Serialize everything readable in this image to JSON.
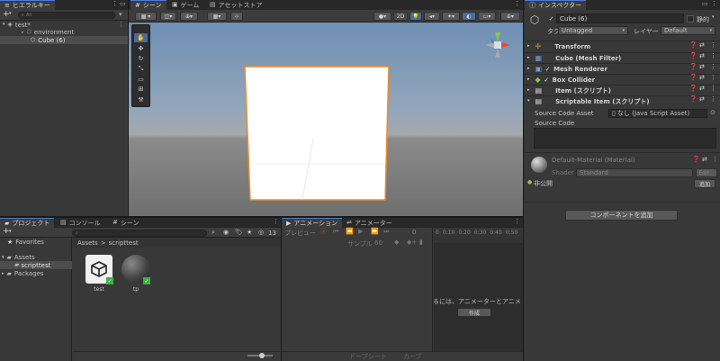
{
  "hierarchy": {
    "tab": "ヒエラルキー",
    "search_placeholder": "All",
    "scene": "test*",
    "items": [
      {
        "label": "environment"
      },
      {
        "label": "Cube (6)"
      }
    ]
  },
  "scene_view": {
    "tabs": [
      {
        "label": "シーン"
      },
      {
        "label": "ゲーム"
      },
      {
        "label": "アセットストア"
      }
    ],
    "toolbar_2d": "2D"
  },
  "inspector": {
    "tab": "インスペクター",
    "object_name": "Cube (6)",
    "static_label": "静的",
    "tag_label": "タグ",
    "tag_value": "Untagged",
    "layer_label": "レイヤー",
    "layer_value": "Default",
    "components": [
      {
        "label": "Transform",
        "icon": "transform-icon"
      },
      {
        "label": "Cube (Mesh Filter)",
        "icon": "mesh-filter-icon"
      },
      {
        "label": "Mesh Renderer",
        "icon": "mesh-renderer-icon"
      },
      {
        "label": "Box Collider",
        "icon": "box-collider-icon"
      },
      {
        "label": "Item (スクリプト)",
        "icon": "script-icon"
      },
      {
        "label": "Scriptable Item (スクリプト)",
        "icon": "script-icon"
      }
    ],
    "source_code_asset_label": "Source Code Asset",
    "source_code_asset_value": "なし (Java Script Asset)",
    "source_code_label": "Source Code",
    "material_name": "Default-Material (Material)",
    "shader_label": "Shader",
    "shader_value": "Standard",
    "edit_label": "Edit...",
    "private_label": "非公開",
    "add_label": "追加",
    "add_component_label": "コンポーネントを追加"
  },
  "project": {
    "tabs": [
      {
        "label": "プロジェクト"
      },
      {
        "label": "コンソール"
      },
      {
        "label": "シーン"
      }
    ],
    "favorites": "Favorites",
    "assets": "Assets",
    "scripttest": "scripttest",
    "packages": "Packages",
    "breadcrumb_root": "Assets",
    "breadcrumb_sep": ">",
    "breadcrumb_leaf": "scripttest",
    "hidden_count": "13",
    "files": [
      {
        "name": "test",
        "icon": "unity-scene-icon"
      },
      {
        "name": "tp",
        "icon": "material-sphere-icon"
      }
    ]
  },
  "animation": {
    "tabs": [
      {
        "label": "アニメーション"
      },
      {
        "label": "アニメーター"
      }
    ],
    "preview_label": "プレビュー",
    "sample_label": "サンプル",
    "sample_value": "60",
    "frame_value": "0",
    "ruler": [
      "0",
      "0:10",
      "0:20",
      "0:30",
      "0:40",
      "0:50"
    ],
    "message": "るには、アニメーターとアニメ",
    "create_label": "作成",
    "dopesheet_label": "ドープシート",
    "curves_label": "カーブ"
  },
  "colors": {
    "accent": "#4a7bd8",
    "selection": "#2c5d87",
    "cube_outline": "#f08a24"
  }
}
